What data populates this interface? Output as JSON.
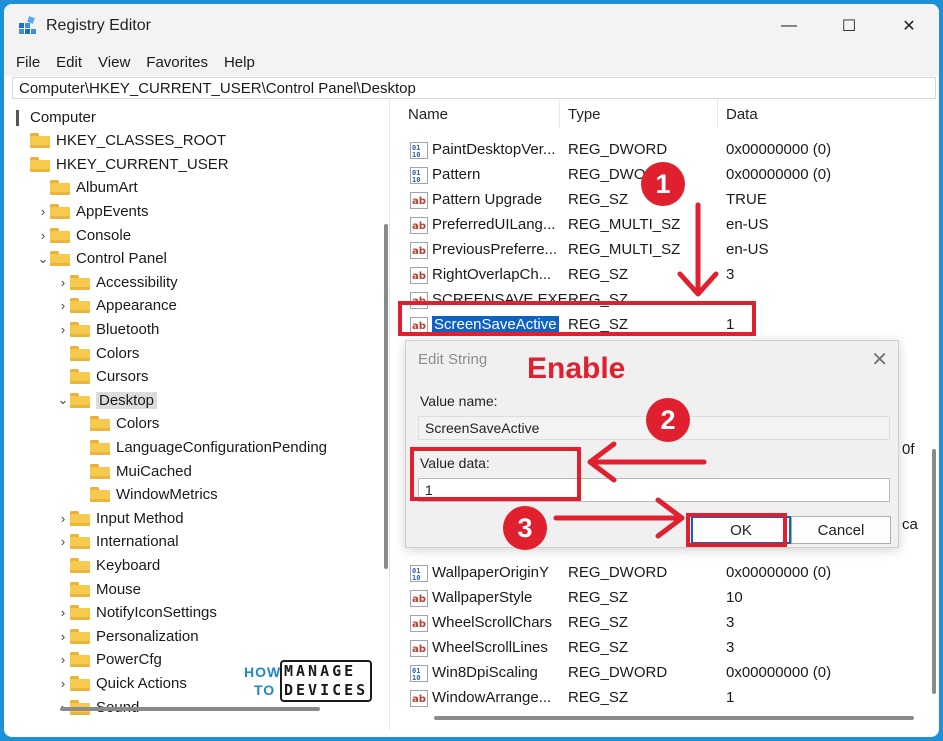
{
  "window": {
    "title": "Registry Editor",
    "minimize": "—",
    "maximize": "☐",
    "close": "✕"
  },
  "menu": [
    "File",
    "Edit",
    "View",
    "Favorites",
    "Help"
  ],
  "address": "Computer\\HKEY_CURRENT_USER\\Control Panel\\Desktop",
  "tree": [
    {
      "label": "Computer",
      "depth": 0,
      "chevron": ""
    },
    {
      "label": "HKEY_CLASSES_ROOT",
      "depth": 0,
      "chevron": ""
    },
    {
      "label": "HKEY_CURRENT_USER",
      "depth": 0,
      "chevron": ""
    },
    {
      "label": "AlbumArt",
      "depth": 1,
      "chevron": ""
    },
    {
      "label": "AppEvents",
      "depth": 1,
      "chevron": "›"
    },
    {
      "label": "Console",
      "depth": 1,
      "chevron": "›"
    },
    {
      "label": "Control Panel",
      "depth": 1,
      "chevron": "⌄"
    },
    {
      "label": "Accessibility",
      "depth": 2,
      "chevron": "›"
    },
    {
      "label": "Appearance",
      "depth": 2,
      "chevron": "›"
    },
    {
      "label": "Bluetooth",
      "depth": 2,
      "chevron": "›"
    },
    {
      "label": "Colors",
      "depth": 2,
      "chevron": ""
    },
    {
      "label": "Cursors",
      "depth": 2,
      "chevron": ""
    },
    {
      "label": "Desktop",
      "depth": 2,
      "chevron": "⌄",
      "selected": true
    },
    {
      "label": "Colors",
      "depth": 3,
      "chevron": ""
    },
    {
      "label": "LanguageConfigurationPending",
      "depth": 3,
      "chevron": ""
    },
    {
      "label": "MuiCached",
      "depth": 3,
      "chevron": ""
    },
    {
      "label": "WindowMetrics",
      "depth": 3,
      "chevron": ""
    },
    {
      "label": "Input Method",
      "depth": 2,
      "chevron": "›"
    },
    {
      "label": "International",
      "depth": 2,
      "chevron": "›"
    },
    {
      "label": "Keyboard",
      "depth": 2,
      "chevron": ""
    },
    {
      "label": "Mouse",
      "depth": 2,
      "chevron": ""
    },
    {
      "label": "NotifyIconSettings",
      "depth": 2,
      "chevron": "›"
    },
    {
      "label": "Personalization",
      "depth": 2,
      "chevron": "›"
    },
    {
      "label": "PowerCfg",
      "depth": 2,
      "chevron": "›"
    },
    {
      "label": "Quick Actions",
      "depth": 2,
      "chevron": "›"
    },
    {
      "label": "Sound",
      "depth": 2,
      "chevron": "›"
    }
  ],
  "columns": {
    "name": "Name",
    "type": "Type",
    "data": "Data"
  },
  "values": [
    {
      "name": "PaintDesktopVer...",
      "type": "REG_DWORD",
      "data": "0x00000000 (0)",
      "icon": "binary-value-icon"
    },
    {
      "name": "Pattern",
      "type": "REG_DWORD",
      "data": "0x00000000 (0)",
      "icon": "binary-value-icon"
    },
    {
      "name": "Pattern Upgrade",
      "type": "REG_SZ",
      "data": "TRUE",
      "icon": "string-value-icon"
    },
    {
      "name": "PreferredUILang...",
      "type": "REG_MULTI_SZ",
      "data": "en-US",
      "icon": "string-value-icon"
    },
    {
      "name": "PreviousPreferre...",
      "type": "REG_MULTI_SZ",
      "data": "en-US",
      "icon": "string-value-icon"
    },
    {
      "name": "RightOverlapCh...",
      "type": "REG_SZ",
      "data": "3",
      "icon": "string-value-icon"
    },
    {
      "name": "SCREENSAVE.EXE",
      "type": "REG_SZ",
      "data": "",
      "icon": "string-value-icon"
    },
    {
      "name": "ScreenSaveActive",
      "type": "REG_SZ",
      "data": "1",
      "icon": "string-value-icon",
      "selected": true
    }
  ],
  "values_below": [
    {
      "name": "WallpaperOriginY",
      "type": "REG_DWORD",
      "data": "0x00000000 (0)",
      "icon": "binary-value-icon"
    },
    {
      "name": "WallpaperStyle",
      "type": "REG_SZ",
      "data": "10",
      "icon": "string-value-icon"
    },
    {
      "name": "WheelScrollChars",
      "type": "REG_SZ",
      "data": "3",
      "icon": "string-value-icon"
    },
    {
      "name": "WheelScrollLines",
      "type": "REG_SZ",
      "data": "3",
      "icon": "string-value-icon"
    },
    {
      "name": "Win8DpiScaling",
      "type": "REG_DWORD",
      "data": "0x00000000 (0)",
      "icon": "binary-value-icon"
    },
    {
      "name": "WindowArrange...",
      "type": "REG_SZ",
      "data": "1",
      "icon": "string-value-icon"
    }
  ],
  "partial_text": {
    "right_0f": "0f",
    "right_ca": "ca"
  },
  "dialog": {
    "title": "Edit String",
    "close": "✕",
    "value_name_label": "Value name:",
    "value_name": "ScreenSaveActive",
    "value_data_label": "Value data:",
    "value_data": "1",
    "ok": "OK",
    "cancel": "Cancel"
  },
  "annotations": {
    "enable": "Enable",
    "step1": "1",
    "step2": "2",
    "step3": "3",
    "color": "#e0202f"
  },
  "logo": {
    "how": "HOW",
    "to": "TO",
    "manage": "MANAGE",
    "devices": "DEVICES"
  },
  "colors": {
    "selection": "#0e62c4",
    "folder": "#f6c94f",
    "frame": "#1e90d8"
  }
}
